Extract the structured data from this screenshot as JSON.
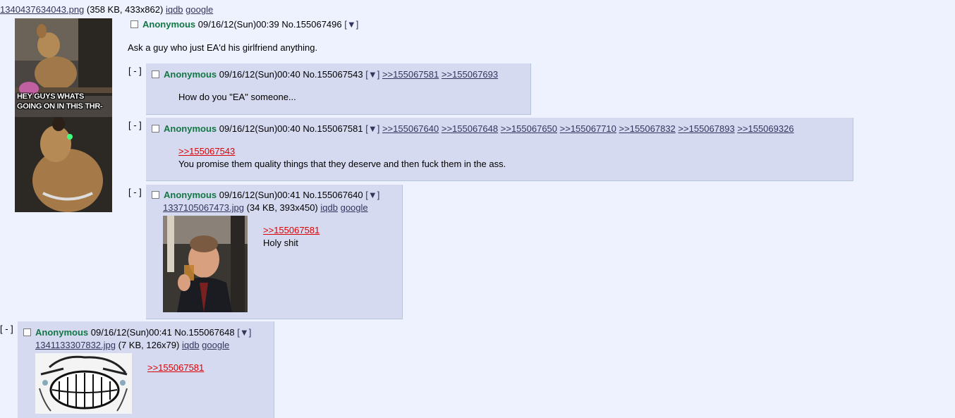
{
  "op": {
    "file_link": "1340437634043.png",
    "file_meta": "(358 KB, 433x862)",
    "iqdb": "iqdb",
    "google": "google",
    "name": "Anonymous",
    "datetime": "09/16/12(Sun)00:39",
    "post_no": "No.155067496",
    "menu_arrow": "[▼]",
    "body": "Ask a guy who just EA'd his girlfriend anything.",
    "image_caption_line1": "HEY GUYS WHATS",
    "image_caption_line2": "GOING ON IN THIS THR-"
  },
  "replies": [
    {
      "toggle": "[ - ]",
      "name": "Anonymous",
      "datetime": "09/16/12(Sun)00:40",
      "post_no": "No.155067543",
      "menu_arrow": "[▼]",
      "backlinks": [
        ">>155067581",
        ">>155067693"
      ],
      "body": "How do you \"EA\" someone..."
    },
    {
      "toggle": "[ - ]",
      "name": "Anonymous",
      "datetime": "09/16/12(Sun)00:40",
      "post_no": "No.155067581",
      "menu_arrow": "[▼]",
      "backlinks": [
        ">>155067640",
        ">>155067648",
        ">>155067650",
        ">>155067710",
        ">>155067832",
        ">>155067893",
        ">>155069326"
      ],
      "quote": ">>155067543",
      "body": "You promise them quality things that they deserve and then fuck them in the ass."
    },
    {
      "toggle": "[ - ]",
      "name": "Anonymous",
      "datetime": "09/16/12(Sun)00:41",
      "post_no": "No.155067640",
      "menu_arrow": "[▼]",
      "file_link": "1337105067473.jpg",
      "file_meta": "(34 KB, 393x450)",
      "iqdb": "iqdb",
      "google": "google",
      "quote": ">>155067581",
      "body": "Holy shit"
    },
    {
      "toggle": "[ - ]",
      "name": "Anonymous",
      "datetime": "09/16/12(Sun)00:41",
      "post_no": "No.155067648",
      "menu_arrow": "[▼]",
      "file_link": "1341133307832.jpg",
      "file_meta": "(7 KB, 126x79)",
      "iqdb": "iqdb",
      "google": "google",
      "quote": ">>155067581"
    }
  ]
}
